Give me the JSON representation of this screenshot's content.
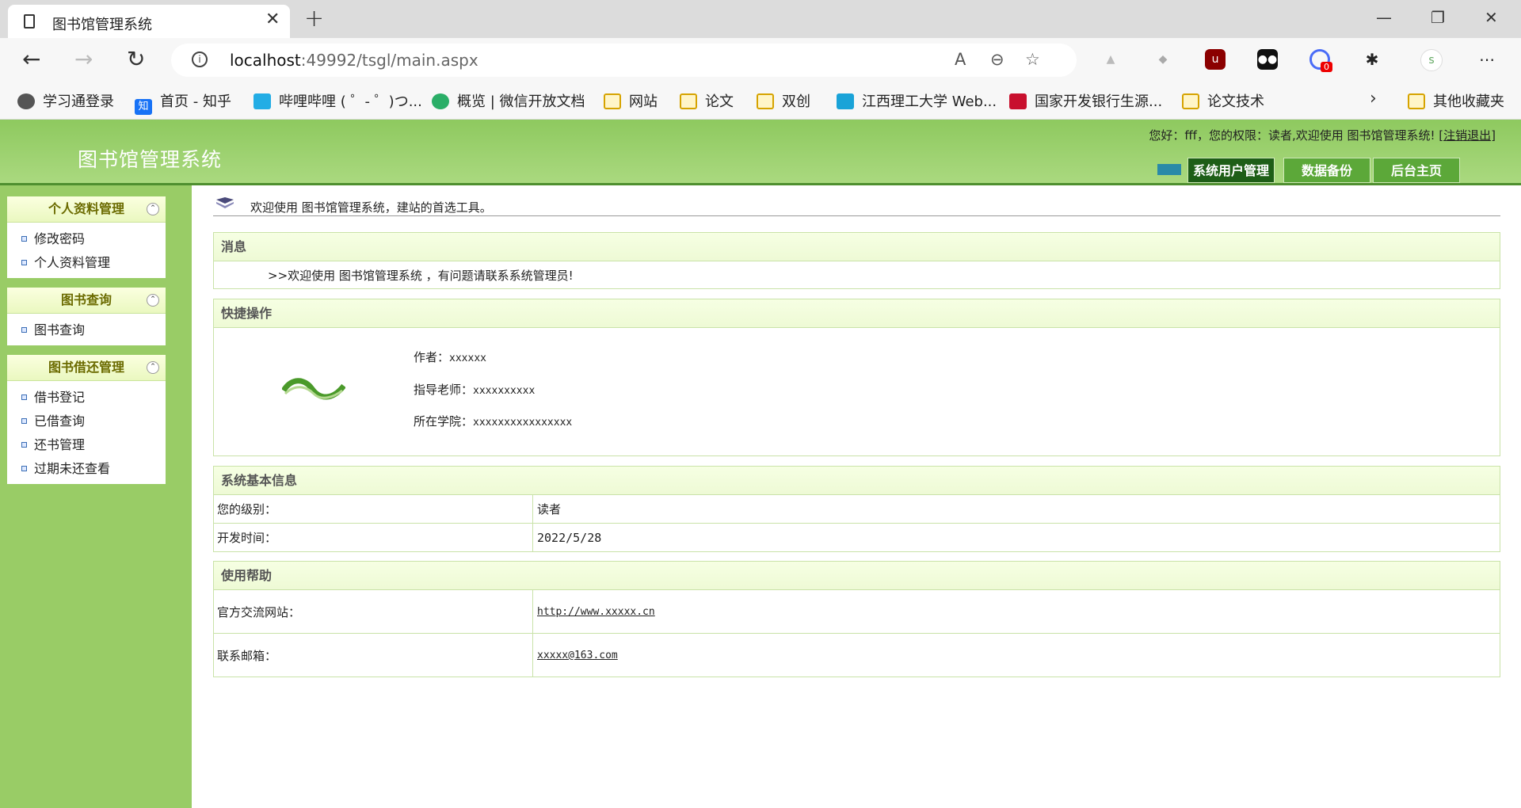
{
  "browser": {
    "tab_title": "图书馆管理系统",
    "new_tab": "+",
    "url_host": "localhost",
    "url_rest": ":49992/tsgl/main.aspx",
    "badge_count": "0",
    "bookmarks": [
      {
        "label": "学习通登录",
        "icon": "globe-icon"
      },
      {
        "label": "首页 - 知乎",
        "icon": "zhihu-icon",
        "badge": "知"
      },
      {
        "label": "哔哩哔哩 ( ゜- ゜)つ...",
        "icon": "bilibili-icon"
      },
      {
        "label": "概览 | 微信开放文档",
        "icon": "wechat-icon"
      },
      {
        "label": "网站",
        "icon": "folder-icon"
      },
      {
        "label": "论文",
        "icon": "folder-icon"
      },
      {
        "label": "双创",
        "icon": "folder-icon"
      },
      {
        "label": "江西理工大学 Web...",
        "icon": "lock-icon"
      },
      {
        "label": "国家开发银行生源...",
        "icon": "bank-icon"
      },
      {
        "label": "论文技术",
        "icon": "folder-icon"
      },
      {
        "label": "其他收藏夹",
        "icon": "folder-icon"
      }
    ]
  },
  "header": {
    "logo": "图书馆管理系统",
    "welcome": "您好：fff，您的权限：读者,欢迎使用 图书馆管理系统!",
    "logout": "[注销退出]",
    "buttons": [
      "系统用户管理",
      "数据备份",
      "后台主页"
    ]
  },
  "sidebar": {
    "panels": [
      {
        "title": "个人资料管理",
        "items": [
          "修改密码",
          "个人资料管理"
        ]
      },
      {
        "title": "图书查询",
        "items": [
          "图书查询"
        ]
      },
      {
        "title": "图书借还管理",
        "items": [
          "借书登记",
          "已借查询",
          "还书管理",
          "过期未还查看"
        ]
      }
    ]
  },
  "main": {
    "greeting": "欢迎使用 图书馆管理系统，建站的首选工具。",
    "message": {
      "title": "消息",
      "text": ">>欢迎使用 图书馆管理系统 ，有问题请联系系统管理员!"
    },
    "quick": {
      "title": "快捷操作",
      "author_label": "作者：",
      "author": "xxxxxx",
      "teacher_label": "指导老师：",
      "teacher": "xxxxxxxxxx",
      "college_label": "所在学院：",
      "college": "xxxxxxxxxxxxxxxx"
    },
    "sysinfo": {
      "title": "系统基本信息",
      "rows": [
        {
          "label": "您的级别：",
          "value": "读者"
        },
        {
          "label": "开发时间：",
          "value": "2022/5/28"
        }
      ]
    },
    "help": {
      "title": "使用帮助",
      "rows": [
        {
          "label": "官方交流网站：",
          "value": "http://www.xxxxx.cn"
        },
        {
          "label": "联系邮箱：",
          "value": "xxxxx@163.com"
        }
      ]
    }
  }
}
